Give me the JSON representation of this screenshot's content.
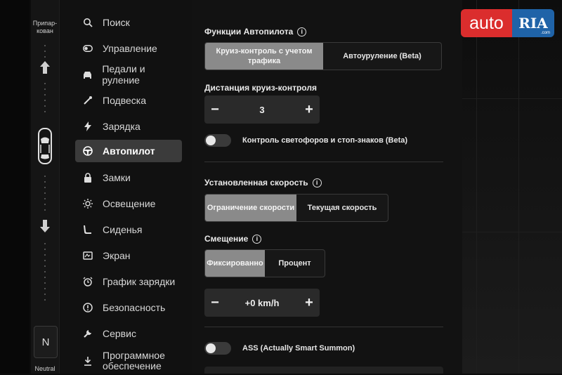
{
  "gear": {
    "park_label": "Припар-\nкован",
    "neutral_label": "Neutral",
    "neutral_letter": "N"
  },
  "sidebar": {
    "items": [
      {
        "label": "Поиск",
        "icon": "search-icon"
      },
      {
        "label": "Управление",
        "icon": "toggle-icon"
      },
      {
        "label": "Педали и руление",
        "icon": "car-icon"
      },
      {
        "label": "Подвеска",
        "icon": "wrench-icon"
      },
      {
        "label": "Зарядка",
        "icon": "bolt-icon"
      },
      {
        "label": "Автопилот",
        "icon": "steering-wheel-icon",
        "active": true
      },
      {
        "label": "Замки",
        "icon": "lock-icon"
      },
      {
        "label": "Освещение",
        "icon": "sun-icon"
      },
      {
        "label": "Сиденья",
        "icon": "seat-icon"
      },
      {
        "label": "Экран",
        "icon": "display-icon"
      },
      {
        "label": "График зарядки",
        "icon": "alarm-clock-icon"
      },
      {
        "label": "Безопасность",
        "icon": "alert-icon"
      },
      {
        "label": "Сервис",
        "icon": "service-wrench-icon"
      },
      {
        "label": "Программное обеспечение",
        "icon": "download-icon"
      }
    ]
  },
  "autopilot": {
    "functions_title": "Функции Автопилота",
    "functions_options": [
      "Круиз-контроль с учетом трафика",
      "Автоуруление (Beta)"
    ],
    "functions_selected": 0,
    "distance_title": "Дистанция круиз-контроля",
    "distance_value": "3",
    "traffic_lights_label": "Контроль светофоров и стоп-знаков (Beta)",
    "set_speed_title": "Установленная скорость",
    "set_speed_options": [
      "Ограничение скорости",
      "Текущая скорость"
    ],
    "set_speed_selected": 0,
    "offset_title": "Смещение",
    "offset_options": [
      "Фиксированно",
      "Процент"
    ],
    "offset_selected": 0,
    "offset_value": "+0 km/h",
    "ass_label": "ASS (Actually Smart Summon)",
    "minus": "−",
    "plus": "+",
    "info": "i"
  },
  "logo": {
    "auto": "auto",
    "ria": "RIA",
    "domain": ".com"
  },
  "colors": {
    "active_item": "#3b3b3b",
    "selected_segment": "#8a8a8a",
    "logo_red": "#db2d2d",
    "logo_blue": "#1f63a8"
  }
}
